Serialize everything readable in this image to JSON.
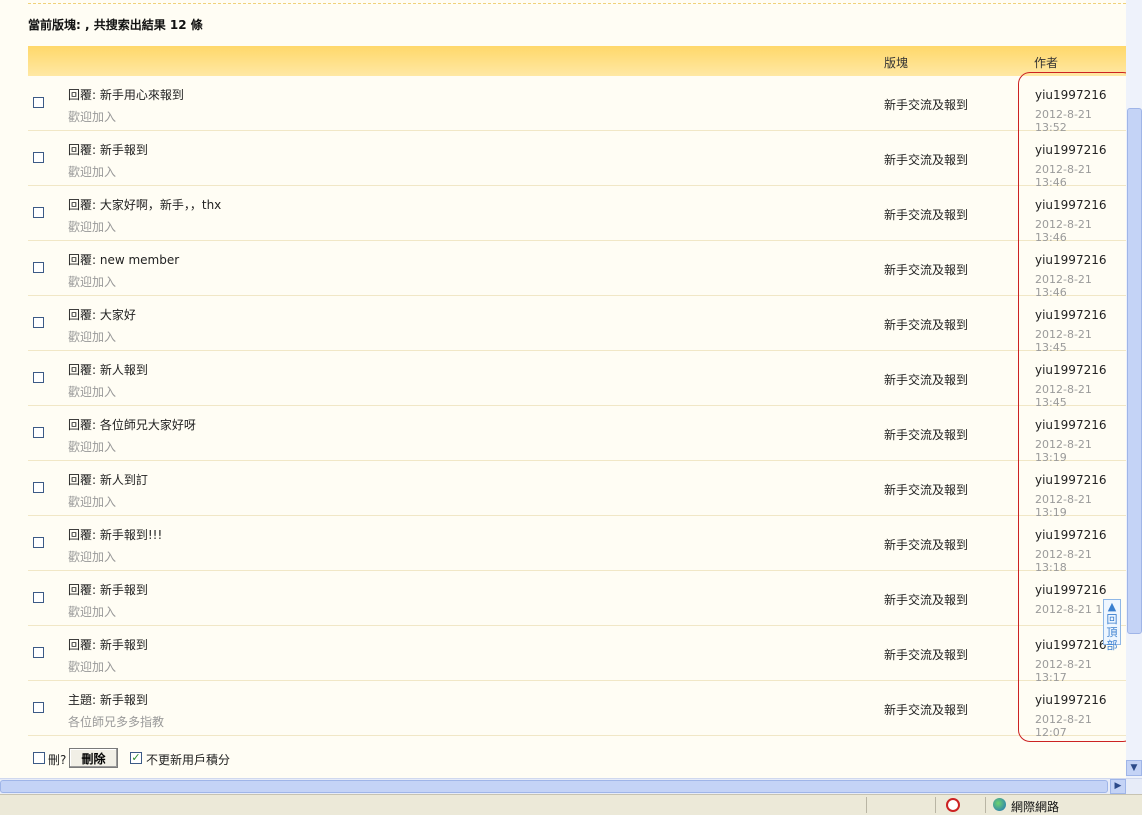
{
  "summary": "當前版塊: , 共搜索出結果 12 條",
  "header": {
    "forum": "版塊",
    "author": "作者"
  },
  "rows": [
    {
      "title": "回覆: 新手用心來報到",
      "subtitle": "歡迎加入",
      "forum": "新手交流及報到",
      "author": "yiu1997216",
      "date": "2012-8-21 13:52"
    },
    {
      "title": "回覆: 新手報到",
      "subtitle": "歡迎加入",
      "forum": "新手交流及報到",
      "author": "yiu1997216",
      "date": "2012-8-21 13:46"
    },
    {
      "title": "回覆: 大家好啊，新手，，thx",
      "subtitle": "歡迎加入",
      "forum": "新手交流及報到",
      "author": "yiu1997216",
      "date": "2012-8-21 13:46"
    },
    {
      "title": "回覆: new member",
      "subtitle": "歡迎加入",
      "forum": "新手交流及報到",
      "author": "yiu1997216",
      "date": "2012-8-21 13:46"
    },
    {
      "title": "回覆: 大家好",
      "subtitle": "歡迎加入",
      "forum": "新手交流及報到",
      "author": "yiu1997216",
      "date": "2012-8-21 13:45"
    },
    {
      "title": "回覆: 新人報到",
      "subtitle": "歡迎加入",
      "forum": "新手交流及報到",
      "author": "yiu1997216",
      "date": "2012-8-21 13:45"
    },
    {
      "title": "回覆: 各位師兄大家好呀",
      "subtitle": "歡迎加入",
      "forum": "新手交流及報到",
      "author": "yiu1997216",
      "date": "2012-8-21 13:19"
    },
    {
      "title": "回覆: 新人到訂",
      "subtitle": "歡迎加入",
      "forum": "新手交流及報到",
      "author": "yiu1997216",
      "date": "2012-8-21 13:19"
    },
    {
      "title": "回覆: 新手報到!!!",
      "subtitle": "歡迎加入",
      "forum": "新手交流及報到",
      "author": "yiu1997216",
      "date": "2012-8-21 13:18"
    },
    {
      "title": "回覆: 新手報到",
      "subtitle": "歡迎加入",
      "forum": "新手交流及報到",
      "author": "yiu1997216",
      "date": "2012-8-21 13:"
    },
    {
      "title": "回覆: 新手報到",
      "subtitle": "歡迎加入",
      "forum": "新手交流及報到",
      "author": "yiu1997216",
      "date": "2012-8-21 13:17"
    },
    {
      "title": "主題: 新手報到",
      "subtitle": "各位師兄多多指教",
      "forum": "新手交流及報到",
      "author": "yiu1997216",
      "date": "2012-8-21 12:07"
    }
  ],
  "footer": {
    "delete_question": "刪?",
    "delete_button": "刪除",
    "keep_checked_mark": "✓",
    "keep_points_label": "不更新用戶積分"
  },
  "backtop_label": "回頂部",
  "scroll_arrows": {
    "down": "▼",
    "right": "▶"
  },
  "statusbar": {
    "zone": "網際網路"
  }
}
